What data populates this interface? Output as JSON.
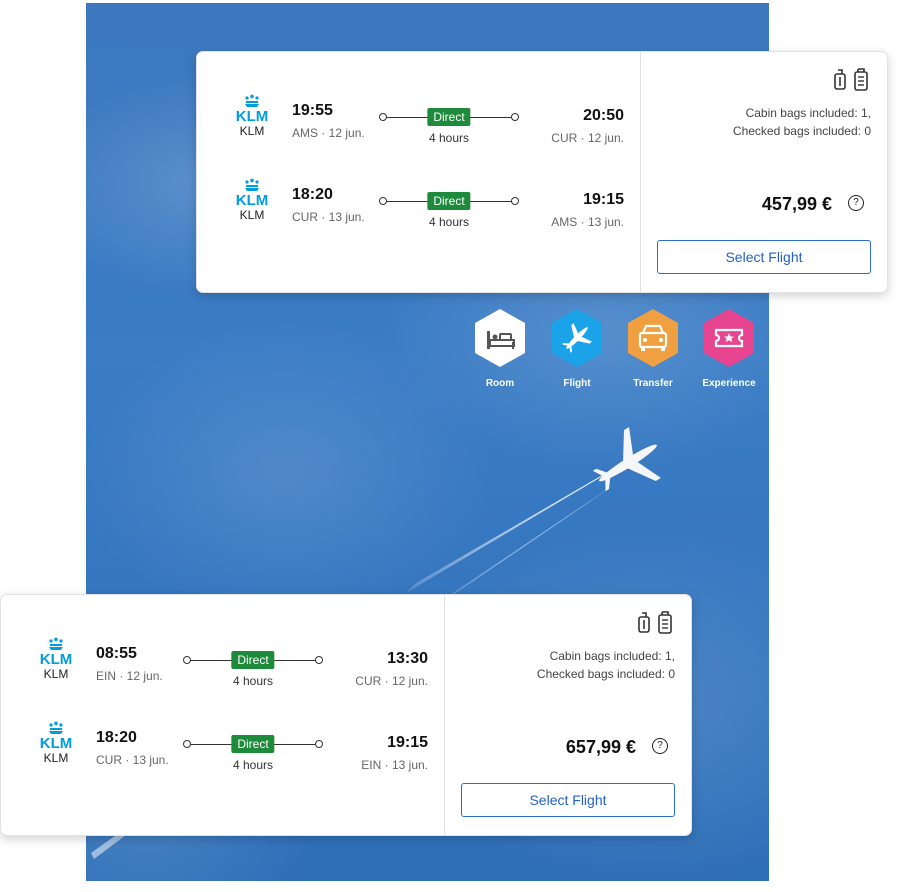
{
  "brand_colors": {
    "direct_badge": "#1e8a3c",
    "select_button": "#2262c8",
    "klm_blue": "#009ddc",
    "room": "#ffffff",
    "flight": "#1aa3e8",
    "transfer": "#f0a040",
    "experience": "#e84590"
  },
  "offers": [
    {
      "legs": [
        {
          "airline": "KLM",
          "dep_time": "19:55",
          "dep_info": "AMS · 12 jun.",
          "badge": "Direct",
          "duration": "4 hours",
          "arr_time": "20:50",
          "arr_info": "CUR · 12 jun."
        },
        {
          "airline": "KLM",
          "dep_time": "18:20",
          "dep_info": "CUR · 13 jun.",
          "badge": "Direct",
          "duration": "4 hours",
          "arr_time": "19:15",
          "arr_info": "AMS · 13 jun."
        }
      ],
      "bags_line1": "Cabin bags included: 1,",
      "bags_line2": "Checked bags included: 0",
      "price": "457,99 €",
      "help": "?",
      "select_label": "Select Flight"
    },
    {
      "legs": [
        {
          "airline": "KLM",
          "dep_time": "08:55",
          "dep_info": "EIN · 12 jun.",
          "badge": "Direct",
          "duration": "4 hours",
          "arr_time": "13:30",
          "arr_info": "CUR · 12 jun."
        },
        {
          "airline": "KLM",
          "dep_time": "18:20",
          "dep_info": "CUR · 13 jun.",
          "badge": "Direct",
          "duration": "4 hours",
          "arr_time": "19:15",
          "arr_info": "EIN · 13 jun."
        }
      ],
      "bags_line1": "Cabin bags included: 1,",
      "bags_line2": "Checked bags included: 0",
      "price": "657,99 €",
      "help": "?",
      "select_label": "Select Flight"
    }
  ],
  "categories": [
    {
      "label": "Room",
      "icon": "bed-icon"
    },
    {
      "label": "Flight",
      "icon": "airplane-icon"
    },
    {
      "label": "Transfer",
      "icon": "car-icon"
    },
    {
      "label": "Experience",
      "icon": "ticket-icon"
    }
  ]
}
